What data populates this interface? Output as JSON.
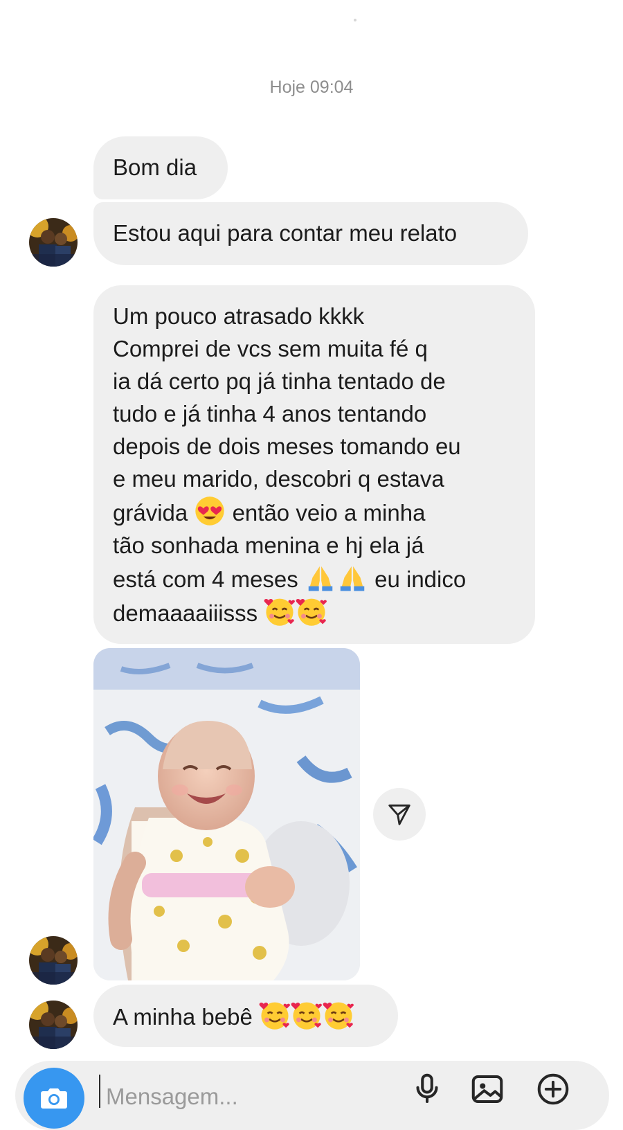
{
  "thread": {
    "timestamp": "Hoje 09:04",
    "messages": [
      {
        "text": "Bom dia"
      },
      {
        "text": "Estou aqui para contar meu relato"
      },
      {
        "lines": [
          "Um pouco atrasado kkkk",
          "Comprei de vcs sem muita fé q",
          "ia dá certo pq já tinha tentado de",
          "tudo e já tinha 4 anos tentando",
          "depois de dois meses tomando eu",
          "e meu marido, descobri q estava",
          "grávida",
          "então veio a minha",
          "tão sonhada menina e hj ela já",
          "está com 4 meses",
          "eu indico",
          "demaaaaiiisss"
        ],
        "emojis": [
          "heart-eyes-emoji",
          "folded-hands-emoji",
          "smiling-face-with-hearts-emoji"
        ]
      },
      {
        "type": "photo",
        "subject": "baby-photo"
      },
      {
        "text": "A minha bebê",
        "emojis": [
          "smiling-face-with-hearts-emoji"
        ]
      }
    ]
  },
  "composer": {
    "placeholder": "Mensagem...",
    "value": "",
    "icons": [
      "camera-icon",
      "microphone-icon",
      "gallery-icon",
      "plus-circle-icon"
    ]
  },
  "colors": {
    "bubble": "#efefef",
    "accent": "#3797f0",
    "timestamp": "#8e8e8e",
    "text": "#1c1c1c"
  }
}
